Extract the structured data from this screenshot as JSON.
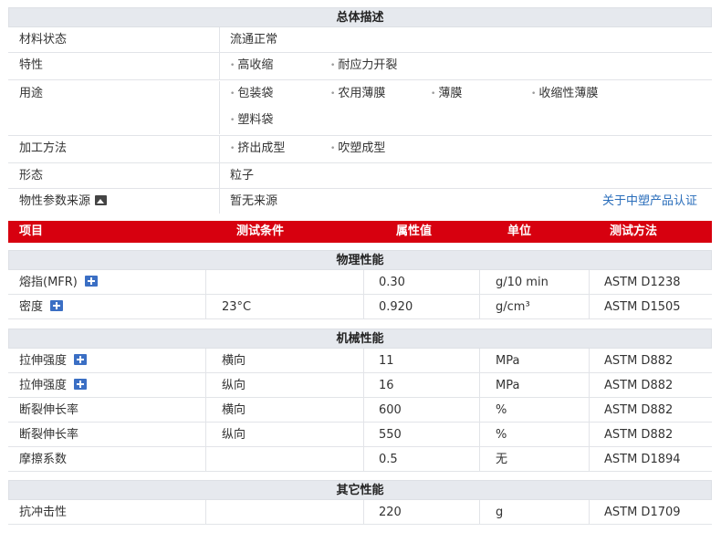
{
  "general": {
    "title": "总体描述",
    "rows": [
      {
        "label": "材料状态",
        "values": [
          "流通正常"
        ]
      },
      {
        "label": "特性",
        "tags": [
          "高收缩",
          "耐应力开裂"
        ]
      },
      {
        "label": "用途",
        "tags": [
          "包装袋",
          "农用薄膜",
          "薄膜",
          "收缩性薄膜",
          "塑料袋"
        ]
      },
      {
        "label": "加工方法",
        "tags": [
          "挤出成型",
          "吹塑成型"
        ]
      },
      {
        "label": "形态",
        "values": [
          "粒子"
        ]
      },
      {
        "label": "物性参数来源",
        "values": [
          "暂无来源"
        ],
        "link": "关于中塑产品认证"
      }
    ]
  },
  "columns": [
    "项目",
    "测试条件",
    "属性值",
    "单位",
    "测试方法"
  ],
  "sections": [
    {
      "title": "物理性能",
      "rows": [
        {
          "item": "熔指(MFR)",
          "plus": true,
          "condition": "",
          "value": "0.30",
          "unit": "g/10 min",
          "method": "ASTM D1238"
        },
        {
          "item": "密度",
          "plus": true,
          "condition": "23°C",
          "value": "0.920",
          "unit": "g/cm³",
          "method": "ASTM D1505"
        }
      ]
    },
    {
      "title": "机械性能",
      "rows": [
        {
          "item": "拉伸强度",
          "plus": true,
          "condition": "横向",
          "value": "11",
          "unit": "MPa",
          "method": "ASTM D882"
        },
        {
          "item": "拉伸强度",
          "plus": true,
          "condition": "纵向",
          "value": "16",
          "unit": "MPa",
          "method": "ASTM D882"
        },
        {
          "item": "断裂伸长率",
          "plus": false,
          "condition": "横向",
          "value": "600",
          "unit": "%",
          "method": "ASTM D882"
        },
        {
          "item": "断裂伸长率",
          "plus": false,
          "condition": "纵向",
          "value": "550",
          "unit": "%",
          "method": "ASTM D882"
        },
        {
          "item": "摩擦系数",
          "plus": false,
          "condition": "",
          "value": "0.5",
          "unit": "无",
          "method": "ASTM D1894"
        }
      ]
    },
    {
      "title": "其它性能",
      "rows": [
        {
          "item": "抗冲击性",
          "plus": false,
          "condition": "",
          "value": "220",
          "unit": "g",
          "method": "ASTM D1709"
        }
      ]
    }
  ],
  "colors": {
    "header_red": "#d7000f",
    "section_gray": "#e6e9ee",
    "link_blue": "#2a6ebb",
    "icon_blue": "#3b6fc4"
  },
  "icons": {
    "plus": "plus-square-icon",
    "source": "picture-icon"
  }
}
